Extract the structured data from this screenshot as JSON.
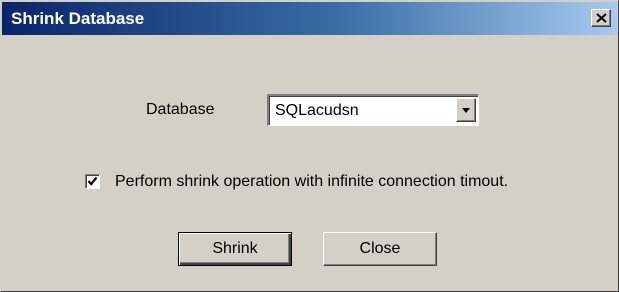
{
  "window": {
    "title": "Shrink Database",
    "close_icon": "close-x-icon",
    "colors": {
      "titlebar_start": "#0a246a",
      "titlebar_end": "#a6caf0",
      "face": "#d4d0c8"
    }
  },
  "form": {
    "database_label": "Database",
    "database_value": "SQLacudsn",
    "dropdown_icon": "chevron-down-icon",
    "checkbox_label": "Perform shrink operation with infinite connection timout.",
    "checkbox_checked": true
  },
  "buttons": {
    "shrink_label": "Shrink",
    "close_label": "Close"
  }
}
